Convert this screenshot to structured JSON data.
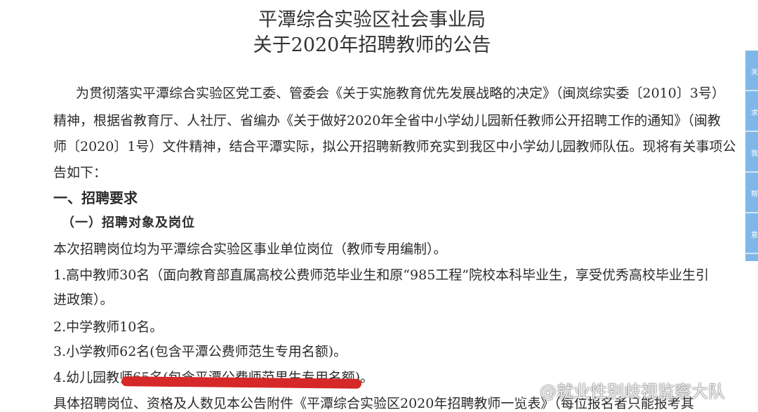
{
  "notice": {
    "title_line1": "平潭综合实验区社会事业局",
    "title_line2": "关于2020年招聘教师的公告",
    "para_intro": [
      "为贯彻落实平潭综合实验区党工委、管委会《关于实施教育优先发展战略的决定》（闽岚综实委〔2010〕3号）",
      "精神，根据省教育厅、人社厅、省编办《关于做好2020年全省中小学幼儿园新任教师公开招聘工作的通知》（闽教",
      "师〔2020〕1号）文件精神，结合平潭实际，拟公开招聘新教师充实到我区中小学幼儿园教师队伍。现将有关事项公",
      "告如下："
    ],
    "section1_heading": "一、招聘要求",
    "subsection1_heading": "（一）招聘对象及岗位",
    "positions_intro": "本次招聘岗位均为平潭综合实验区事业单位岗位（教师专用编制）。",
    "item1_line1": "1.高中教师30名（面向教育部直属高校公费师范毕业生和原“985工程”院校本科毕业生，享受优秀高校毕业生引",
    "item1_line2": "进政策）。",
    "item2": "2.中学教师10名。",
    "item3": "3.小学教师62名(包含平潭公费师范生专用名额)。",
    "item4": "4.幼儿园教师65名(包含平潭公费师范男生专用名额)。",
    "last_line": "具体招聘岗位、资格及人数见本公告附件《平潭综合实验区2020年招聘教师一览表》（每位报名者只能报考其"
  },
  "sidebar": {
    "tabs": [
      "关",
      "求",
      "我",
      "帮",
      "意"
    ]
  },
  "watermark": {
    "text": "@就业性别歧视监察大队",
    "icon": "weibo-icon"
  },
  "colors": {
    "highlight": "#d62828",
    "sidebar": "#7fb8e8"
  }
}
